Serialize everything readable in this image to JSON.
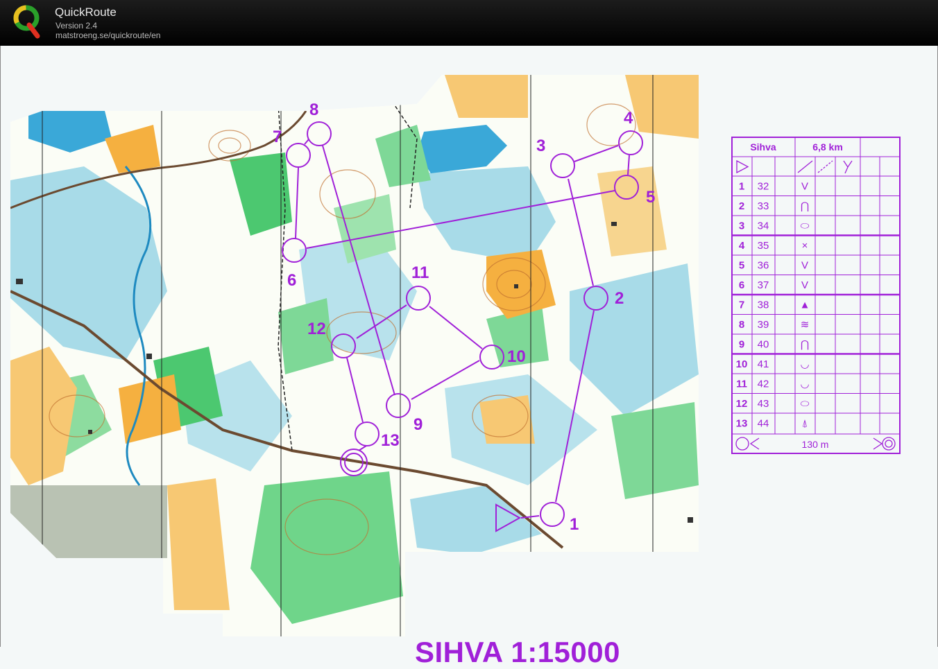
{
  "app": {
    "name": "QuickRoute",
    "version": "Version 2.4",
    "url": "matstroeng.se/quickroute/en"
  },
  "map": {
    "title": "SIHVA 1:15000",
    "course_color": "#a020d8",
    "controls": [
      {
        "label": "1"
      },
      {
        "label": "2"
      },
      {
        "label": "3"
      },
      {
        "label": "4"
      },
      {
        "label": "5"
      },
      {
        "label": "6"
      },
      {
        "label": "7"
      },
      {
        "label": "8"
      },
      {
        "label": "9"
      },
      {
        "label": "10"
      },
      {
        "label": "11"
      },
      {
        "label": "12"
      },
      {
        "label": "13"
      }
    ]
  },
  "description_sheet": {
    "event": "Sihva",
    "length": "6,8 km",
    "rows": [
      {
        "num": "1",
        "code": "32",
        "symbol": "V"
      },
      {
        "num": "2",
        "code": "33",
        "symbol": "⋂"
      },
      {
        "num": "3",
        "code": "34",
        "symbol": "⬭"
      },
      {
        "num": "4",
        "code": "35",
        "symbol": "×"
      },
      {
        "num": "5",
        "code": "36",
        "symbol": "V"
      },
      {
        "num": "6",
        "code": "37",
        "symbol": "V"
      },
      {
        "num": "7",
        "code": "38",
        "symbol": "▲"
      },
      {
        "num": "8",
        "code": "39",
        "symbol": "≋"
      },
      {
        "num": "9",
        "code": "40",
        "symbol": "⋂"
      },
      {
        "num": "10",
        "code": "41",
        "symbol": "◡"
      },
      {
        "num": "11",
        "code": "42",
        "symbol": "◡"
      },
      {
        "num": "12",
        "code": "43",
        "symbol": "⬭"
      },
      {
        "num": "13",
        "code": "44",
        "symbol": "⍋"
      }
    ],
    "finish_distance": "130 m"
  }
}
